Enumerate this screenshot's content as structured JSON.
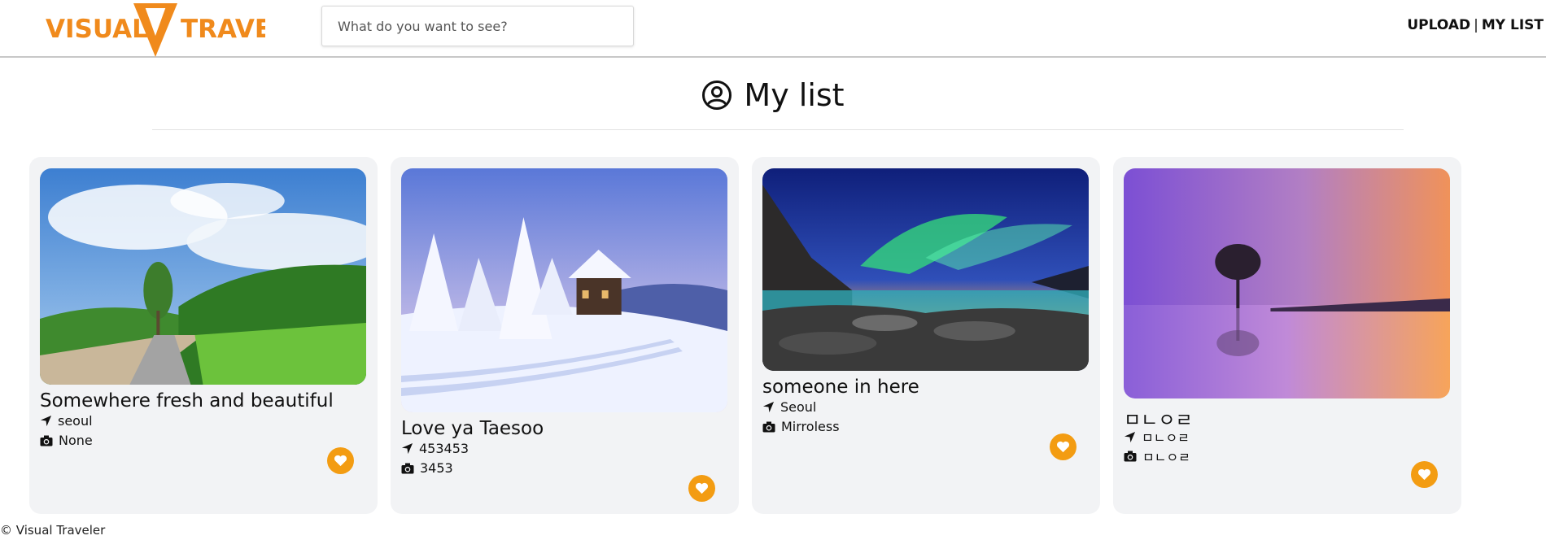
{
  "header": {
    "logo": {
      "word_left": "VISUAL",
      "word_right": "TRAVEL",
      "monogram": "VT",
      "color": "#f08a1c"
    },
    "search": {
      "placeholder": "What do you want to see?",
      "value": ""
    },
    "nav": {
      "upload": "UPLOAD",
      "separator": "|",
      "my_list": "MY LIST"
    }
  },
  "page": {
    "title": "My list",
    "title_icon": "user-circle-icon"
  },
  "cards": [
    {
      "title": "Somewhere fresh and beautiful",
      "location": "seoul",
      "camera": "None",
      "image": "green-park-road-photo"
    },
    {
      "title": "Love ya Taesoo",
      "location": "453453",
      "camera": "3453",
      "image": "snowy-cabin-photo"
    },
    {
      "title": "someone in here",
      "location": "Seoul",
      "camera": "Mirroless",
      "image": "aurora-coast-photo"
    },
    {
      "title": "ㅁㄴㅇㄹ",
      "location": "ㅁㄴㅇㄹ",
      "camera": "ㅁㄴㅇㄹ",
      "image": "lone-tree-sunset-photo"
    }
  ],
  "icons": {
    "location": "location-arrow-icon",
    "camera": "camera-icon",
    "like": "heart-icon"
  },
  "colors": {
    "accent": "#f39c12",
    "card_bg": "#f2f3f5"
  },
  "footer": {
    "text": "© Visual Traveler"
  }
}
